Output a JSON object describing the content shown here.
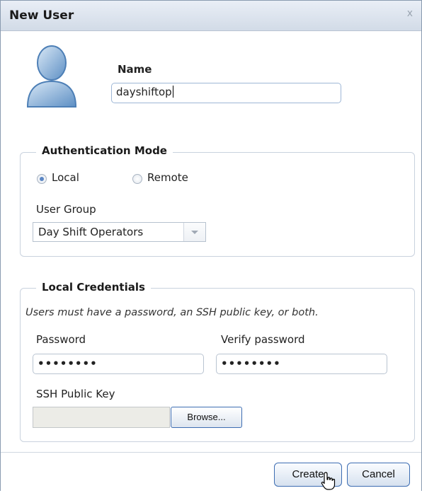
{
  "dialog": {
    "title": "New User",
    "close_glyph": "x"
  },
  "icons": {
    "avatar": "user-avatar-icon",
    "close": "close-icon",
    "dropdown": "chevron-down-icon",
    "cursor": "hand-pointer-icon"
  },
  "name": {
    "label": "Name",
    "value": "dayshiftop"
  },
  "authentication": {
    "legend": "Authentication Mode",
    "options": [
      {
        "label": "Local",
        "selected": true
      },
      {
        "label": "Remote",
        "selected": false
      }
    ],
    "user_group_label": "User Group",
    "user_group_value": "Day Shift Operators"
  },
  "credentials": {
    "legend": "Local Credentials",
    "note": "Users must have a password, an SSH public key, or both.",
    "password_label": "Password",
    "password_value": "••••••••",
    "verify_label": "Verify password",
    "verify_value": "••••••••",
    "ssh_label": "SSH Public Key",
    "browse_label": "Browse..."
  },
  "footer": {
    "create_label": "Create",
    "cancel_label": "Cancel"
  },
  "colors": {
    "accent": "#3d6db2",
    "titlebar": "#d2dbe7",
    "radio_selected": "#5b86c4"
  }
}
